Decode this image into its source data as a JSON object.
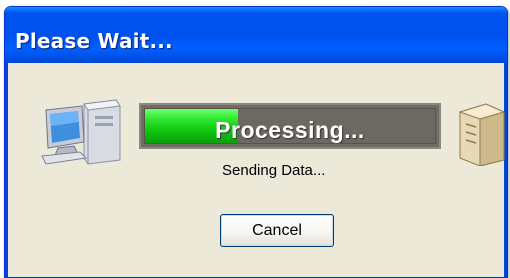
{
  "window": {
    "title": "Please Wait..."
  },
  "progress": {
    "label": "Processing...",
    "fraction": 0.32,
    "fill_color": "#1fd61f"
  },
  "status": {
    "text": "Sending Data..."
  },
  "buttons": {
    "cancel": "Cancel"
  },
  "icons": {
    "left": "computer-icon",
    "right": "server-icon"
  },
  "colors": {
    "titlebar": "#0054e3",
    "dialog_bg": "#ece9d8"
  }
}
